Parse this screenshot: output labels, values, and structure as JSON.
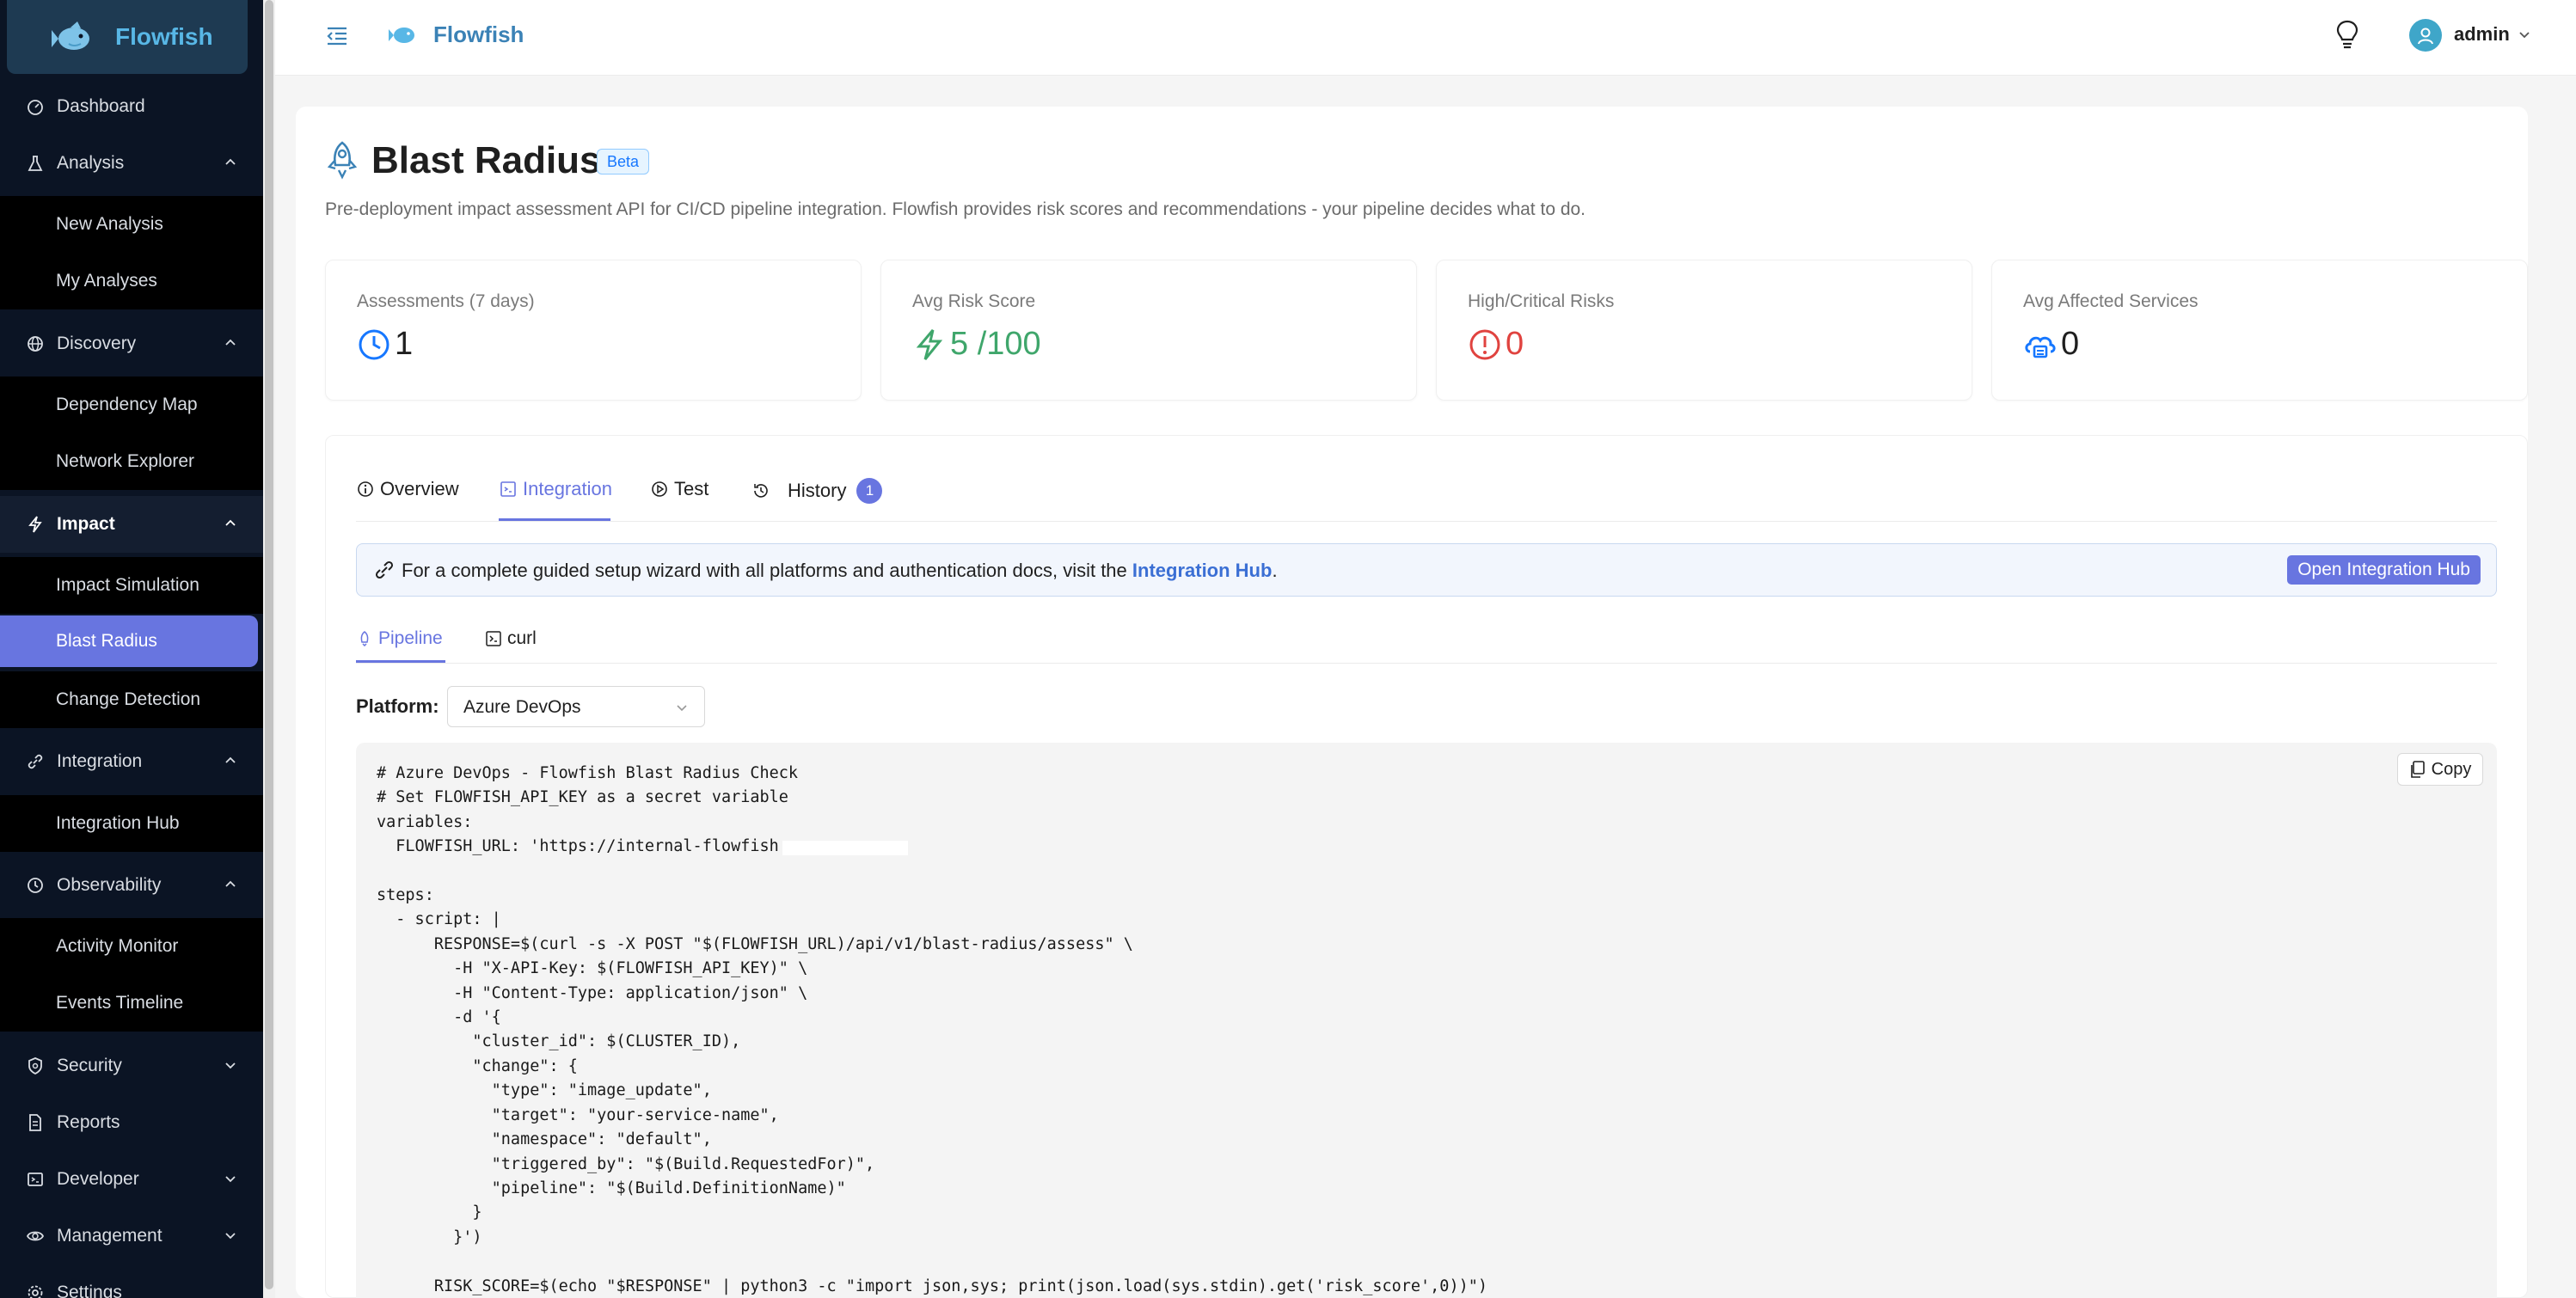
{
  "app": {
    "name": "Flowfish"
  },
  "sidebar": {
    "items": [
      {
        "label": "Dashboard"
      },
      {
        "label": "Analysis"
      },
      {
        "label": "New Analysis"
      },
      {
        "label": "My Analyses"
      },
      {
        "label": "Discovery"
      },
      {
        "label": "Dependency Map"
      },
      {
        "label": "Network Explorer"
      },
      {
        "label": "Impact"
      },
      {
        "label": "Impact Simulation"
      },
      {
        "label": "Blast Radius"
      },
      {
        "label": "Change Detection"
      },
      {
        "label": "Integration"
      },
      {
        "label": "Integration Hub"
      },
      {
        "label": "Observability"
      },
      {
        "label": "Activity Monitor"
      },
      {
        "label": "Events Timeline"
      },
      {
        "label": "Security"
      },
      {
        "label": "Reports"
      },
      {
        "label": "Developer"
      },
      {
        "label": "Management"
      },
      {
        "label": "Settings"
      }
    ]
  },
  "header": {
    "title": "Flowfish",
    "user": "admin"
  },
  "page": {
    "title": "Blast Radius",
    "badge": "Beta",
    "subtitle": "Pre-deployment impact assessment API for CI/CD pipeline integration. Flowfish provides risk scores and recommendations - your pipeline decides what to do."
  },
  "stats": [
    {
      "label": "Assessments (7 days)",
      "value": "1",
      "icon": "clock-icon",
      "color": "#1f1f1f",
      "icon_color": "#1677ff"
    },
    {
      "label": "Avg Risk Score",
      "value": "5 /100",
      "icon": "bolt-icon",
      "color": "#3fa66b",
      "icon_color": "#3fa66b"
    },
    {
      "label": "High/Critical Risks",
      "value": "0",
      "icon": "exclamation-circle-icon",
      "color": "#e0433f",
      "icon_color": "#e0433f"
    },
    {
      "label": "Avg Affected Services",
      "value": "0",
      "icon": "cloud-server-icon",
      "color": "#1f1f1f",
      "icon_color": "#1677ff"
    }
  ],
  "tabs": [
    {
      "label": "Overview",
      "icon": "info-circle-icon"
    },
    {
      "label": "Integration",
      "icon": "code-icon",
      "active": true
    },
    {
      "label": "Test",
      "icon": "play-circle-icon"
    },
    {
      "label": "History",
      "icon": "history-icon",
      "badge": "1"
    }
  ],
  "alert": {
    "text": "For a complete guided setup wizard with all platforms and authentication docs, visit the ",
    "link": "Integration Hub",
    "end": ".",
    "button": "Open Integration Hub"
  },
  "subtabs": [
    {
      "label": "Pipeline",
      "icon": "rocket-icon",
      "active": true
    },
    {
      "label": "curl",
      "icon": "terminal-icon"
    }
  ],
  "platform": {
    "label": "Platform:",
    "value": "Azure DevOps"
  },
  "code": {
    "copy_label": "Copy",
    "text": "# Azure DevOps - Flowfish Blast Radius Check\n# Set FLOWFISH_API_KEY as a secret variable\nvariables:\n  FLOWFISH_URL: 'https://internal-flowfish.\n\nsteps:\n  - script: |\n      RESPONSE=$(curl -s -X POST \"$(FLOWFISH_URL)/api/v1/blast-radius/assess\" \\\n        -H \"X-API-Key: $(FLOWFISH_API_KEY)\" \\\n        -H \"Content-Type: application/json\" \\\n        -d '{\n          \"cluster_id\": $(CLUSTER_ID),\n          \"change\": {\n            \"type\": \"image_update\",\n            \"target\": \"your-service-name\",\n            \"namespace\": \"default\",\n            \"triggered_by\": \"$(Build.RequestedFor)\",\n            \"pipeline\": \"$(Build.DefinitionName)\"\n          }\n        }')\n\n      RISK_SCORE=$(echo \"$RESPONSE\" | python3 -c \"import json,sys; print(json.load(sys.stdin).get('risk_score',0))\")"
  }
}
